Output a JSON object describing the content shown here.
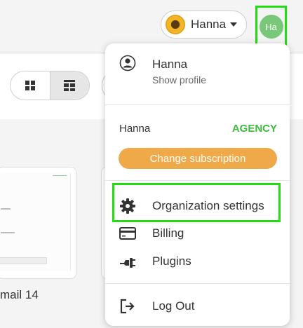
{
  "header": {
    "user_name": "Hanna",
    "avatar_initials": "Ha"
  },
  "main": {
    "card_label": "mail 14"
  },
  "menu": {
    "profile": {
      "name": "Hanna",
      "subtitle": "Show profile"
    },
    "plan": {
      "user": "Hanna",
      "plan_name": "AGENCY",
      "change_button": "Change subscription"
    },
    "items": [
      {
        "label": "Organization settings",
        "icon": "gear-icon"
      },
      {
        "label": "Billing",
        "icon": "credit-card-icon"
      },
      {
        "label": "Plugins",
        "icon": "plug-icon"
      }
    ],
    "logout": {
      "label": "Log Out",
      "icon": "logout-icon"
    }
  },
  "colors": {
    "accent_green": "#3dbb3d",
    "subscription_button": "#f0a948",
    "avatar_bg": "#79c779",
    "highlight": "#22dd11"
  }
}
